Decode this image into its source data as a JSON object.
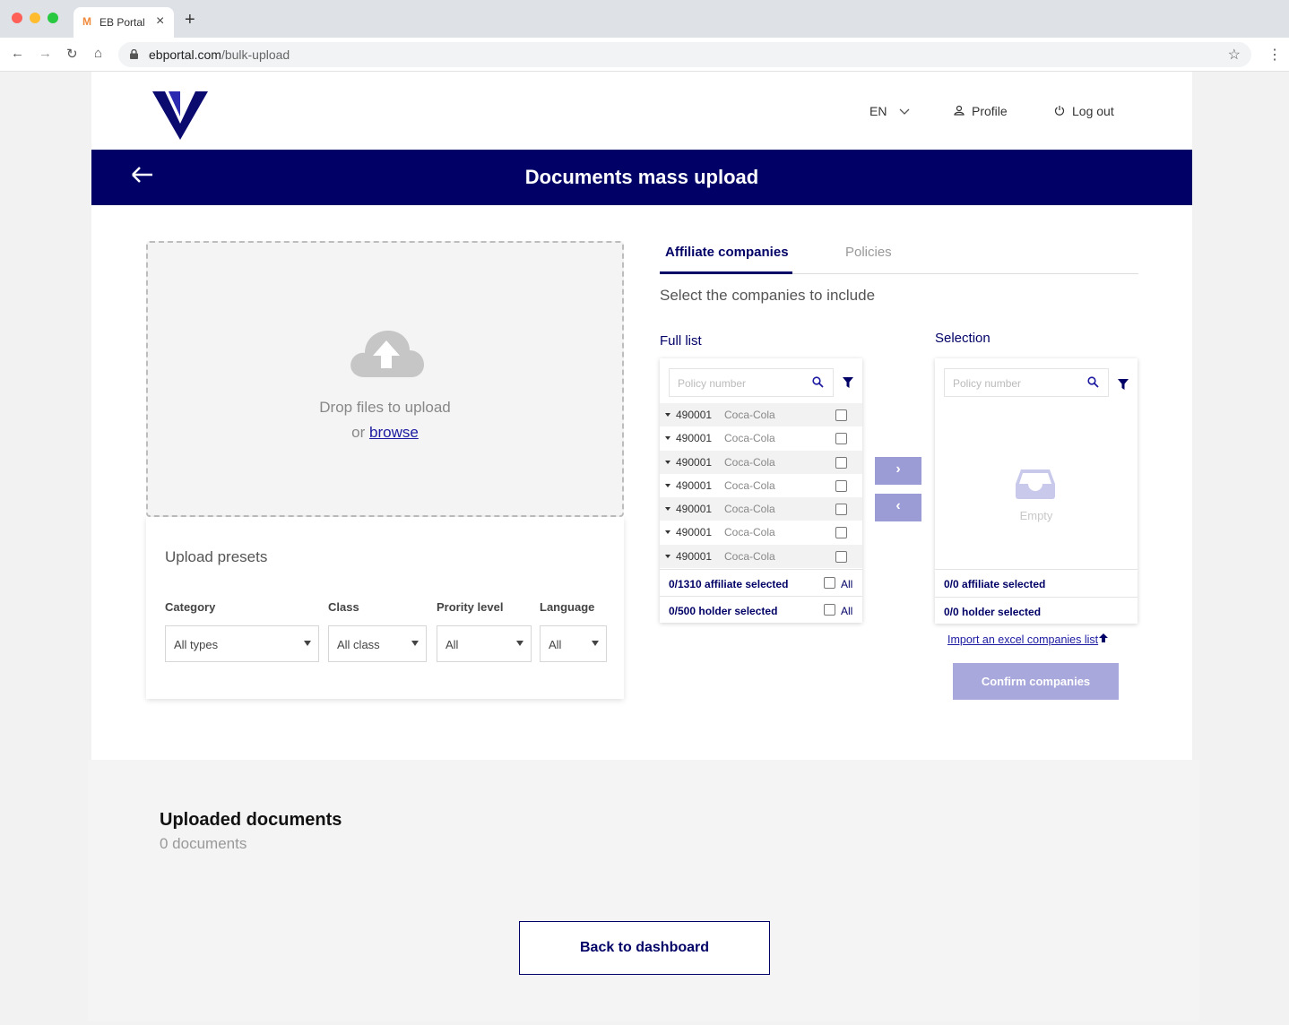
{
  "browser": {
    "tab_favicon": "M",
    "tab_title": "EB Portal",
    "tab_close": "×",
    "new_tab": "+",
    "url_domain": "ebportal.com",
    "url_path": "/bulk-upload"
  },
  "header": {
    "language": "EN",
    "profile": "Profile",
    "logout": "Log out"
  },
  "banner": {
    "title": "Documents mass upload"
  },
  "dropzone": {
    "text": "Drop files to upload",
    "or": "or",
    "browse": "browse"
  },
  "presets": {
    "title": "Upload presets",
    "fields": [
      {
        "label": "Category",
        "value": "All types"
      },
      {
        "label": "Class",
        "value": "All class"
      },
      {
        "label": "Prority level",
        "value": "All"
      },
      {
        "label": "Language",
        "value": "All"
      }
    ]
  },
  "tabs": {
    "affiliate": "Affiliate companies",
    "policies": "Policies"
  },
  "select_instruction": "Select the companies to include",
  "full_list": {
    "title": "Full list",
    "search_placeholder": "Policy number",
    "rows": [
      {
        "number": "490001",
        "name": "Coca-Cola"
      },
      {
        "number": "490001",
        "name": "Coca-Cola"
      },
      {
        "number": "490001",
        "name": "Coca-Cola"
      },
      {
        "number": "490001",
        "name": "Coca-Cola"
      },
      {
        "number": "490001",
        "name": "Coca-Cola"
      },
      {
        "number": "490001",
        "name": "Coca-Cola"
      },
      {
        "number": "490001",
        "name": "Coca-Cola"
      }
    ],
    "affiliate_count": "0/1310 affiliate selected",
    "holder_count": "0/500 holder selected",
    "all_label": "All"
  },
  "selection": {
    "title": "Selection",
    "search_placeholder": "Policy number",
    "empty": "Empty",
    "affiliate_count": "0/0 affiliate selected",
    "holder_count": "0/0 holder selected"
  },
  "move_buttons": {
    "add": "›",
    "remove": "‹"
  },
  "import_link": "Import an excel companies list",
  "confirm": "Confirm companies",
  "uploaded": {
    "title": "Uploaded documents",
    "count": "0 documents"
  },
  "back_to_dashboard": "Back to dashboard",
  "colors": {
    "brand": "#010066",
    "accent_light": "#9b9bd6"
  }
}
